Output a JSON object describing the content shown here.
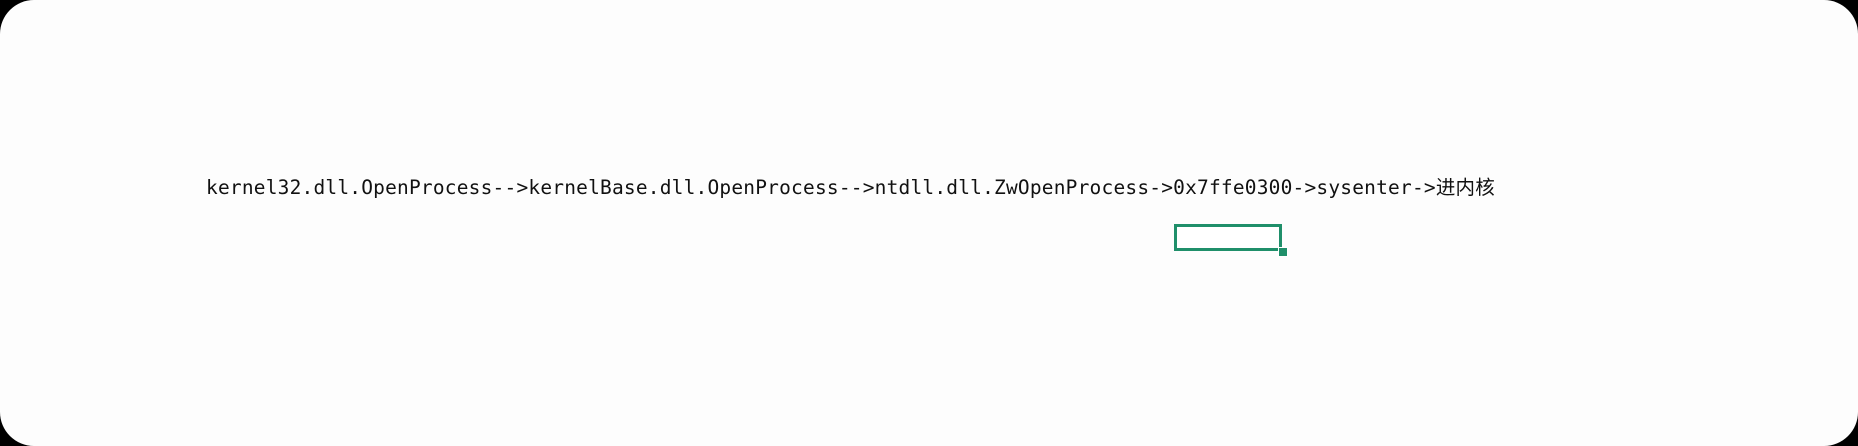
{
  "sheet": {
    "cell_text": "kernel32.dll.OpenProcess-->kernelBase.dll.OpenProcess-->ntdll.dll.ZwOpenProcess->0x7ffe0300->sysenter->进内核",
    "selection_color": "#1f8f6a"
  }
}
